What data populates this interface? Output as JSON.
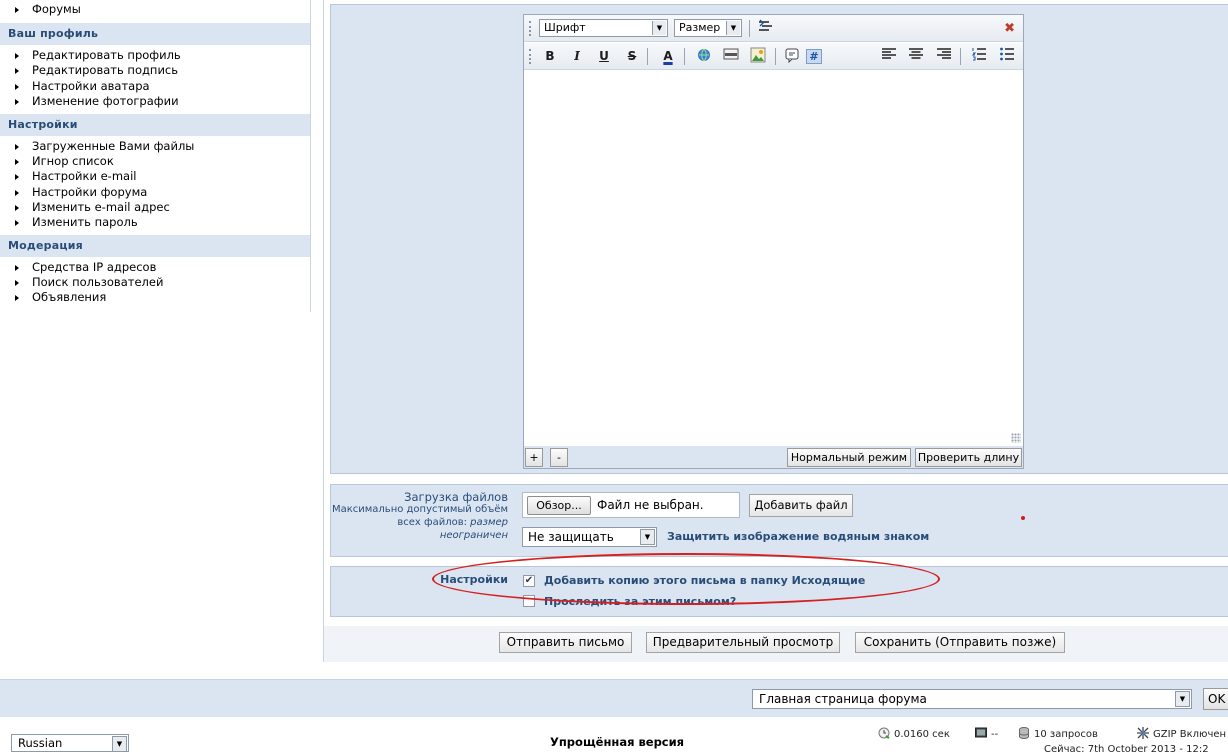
{
  "sidebar": {
    "forums_item": "Форумы",
    "sections": [
      {
        "title": "Ваш профиль",
        "items": [
          "Редактировать профиль",
          "Редактировать подпись",
          "Настройки аватара",
          "Изменение фотографии"
        ]
      },
      {
        "title": "Настройки",
        "items": [
          "Загруженные Вами файлы",
          "Игнор список",
          "Настройки e-mail",
          "Настройки форума",
          "Изменить e-mail адрес",
          "Изменить пароль"
        ]
      },
      {
        "title": "Модерация",
        "items": [
          "Средства IP адресов",
          "Поиск пользователей",
          "Объявления"
        ]
      }
    ]
  },
  "editor": {
    "font_label": "Шрифт",
    "size_label": "Размер",
    "text": "",
    "plus_label": "+",
    "minus_label": "-",
    "normal_mode_label": "Нормальный режим",
    "check_length_label": "Проверить длину"
  },
  "upload": {
    "title": "Загрузка файлов",
    "desc_plain": "Максимально допустимый объём всех файлов:",
    "desc_italic": "размер неограничен",
    "browse_label": "Обзор...",
    "file_status": "Файл не выбран.",
    "add_file_label": "Добавить файл",
    "watermark_selected": "Не защищать",
    "watermark_label": "Защитить изображение водяным знаком"
  },
  "options": {
    "title": "Настройки",
    "copy_outbox": "Добавить копию этого письма в папку Исходящие",
    "copy_outbox_checked": true,
    "track_message": "Проследить за этим письмом?",
    "track_message_checked": false
  },
  "submit": {
    "send": "Отправить письмо",
    "preview": "Предварительный просмотр",
    "save_later": "Сохранить (Отправить позже)"
  },
  "nav": {
    "jump_selected": "Главная страница форума",
    "ok_label": "OK"
  },
  "footer": {
    "language": "Russian",
    "lofi": "Упрощённая версия",
    "exec_time": "0.0160 сек",
    "load": "--",
    "queries": "10  запросов",
    "gzip": "GZIP Включен",
    "now": "Сейчас: 7th October 2013 - 12:2"
  },
  "colors": {
    "panel_bg": "#dbe5f1",
    "label_blue": "#294d79",
    "annotation_red": "#d62020"
  }
}
